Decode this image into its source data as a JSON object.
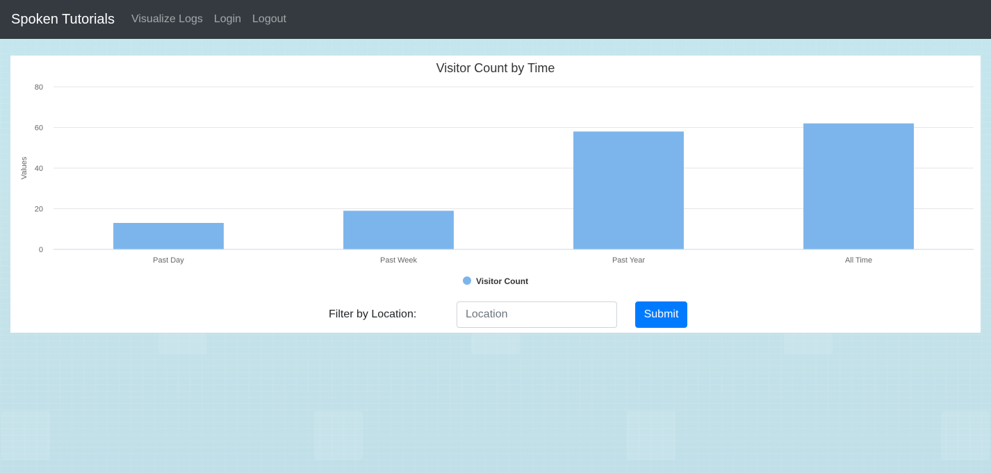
{
  "navbar": {
    "brand": "Spoken Tutorials",
    "links": [
      "Visualize Logs",
      "Login",
      "Logout"
    ]
  },
  "chart_data": {
    "type": "bar",
    "title": "Visitor Count by Time",
    "categories": [
      "Past Day",
      "Past Week",
      "Past Year",
      "All Time"
    ],
    "series": [
      {
        "name": "Visitor Count",
        "values": [
          13,
          19,
          58,
          62
        ],
        "color": "#7cb5ec"
      }
    ],
    "xlabel": "",
    "ylabel": "Values",
    "ylim": [
      0,
      80
    ],
    "yticks": [
      0,
      20,
      40,
      60,
      80
    ],
    "grid": true,
    "legend_position": "bottom-center"
  },
  "filter": {
    "label": "Filter by Location:",
    "placeholder": "Location",
    "value": "",
    "submit_label": "Submit"
  },
  "colors": {
    "navbar_bg": "#343a40",
    "bar": "#7cb5ec",
    "submit_button": "#007bff"
  }
}
